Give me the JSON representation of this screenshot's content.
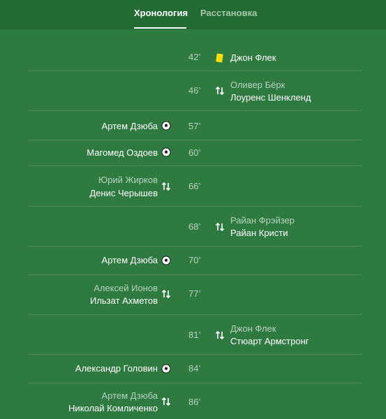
{
  "tabs": [
    {
      "label": "Хронология",
      "active": true
    },
    {
      "label": "Расстановка",
      "active": false
    }
  ],
  "colors": {
    "background": "#2f7a41",
    "header": "#246a34",
    "yellow_card": "#ffde00"
  },
  "events": [
    {
      "minute": "42’",
      "side": "right",
      "type": "yellow-card",
      "player": "Джон Флек"
    },
    {
      "minute": "46’",
      "side": "right",
      "type": "substitution",
      "out": "Оливер Бёрк",
      "in": "Лоуренс Шенкленд"
    },
    {
      "minute": "57’",
      "side": "left",
      "type": "goal",
      "player": "Артем Дзюба"
    },
    {
      "minute": "60’",
      "side": "left",
      "type": "goal",
      "player": "Магомед Оздоев"
    },
    {
      "minute": "66’",
      "side": "left",
      "type": "substitution",
      "out": "Юрий Жирков",
      "in": "Денис Черышев"
    },
    {
      "minute": "68’",
      "side": "right",
      "type": "substitution",
      "out": "Райан Фрэйзер",
      "in": "Райан Кристи"
    },
    {
      "minute": "70’",
      "side": "left",
      "type": "goal",
      "player": "Артем Дзюба"
    },
    {
      "minute": "77’",
      "side": "left",
      "type": "substitution",
      "out": "Алексей Ионов",
      "in": "Ильзат Ахметов"
    },
    {
      "minute": "81’",
      "side": "right",
      "type": "substitution",
      "out": "Джон Флек",
      "in": "Стюарт Армстронг"
    },
    {
      "minute": "84’",
      "side": "left",
      "type": "goal",
      "player": "Александр Головин"
    },
    {
      "minute": "86’",
      "side": "left",
      "type": "substitution",
      "out": "Артем Дзюба",
      "in": "Николай Комличенко"
    }
  ]
}
